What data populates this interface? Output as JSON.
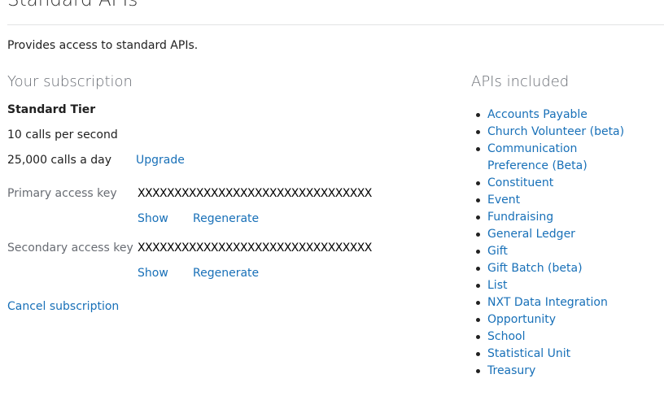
{
  "product": {
    "title": "Standard APIs",
    "description": "Provides access to standard APIs."
  },
  "subscription": {
    "heading": "Your subscription",
    "tier": "Standard Tier",
    "rate_limit": "10 calls per second",
    "daily_quota": "25,000 calls a day",
    "upgrade_label": "Upgrade",
    "primary_key": {
      "label": "Primary access key",
      "value": "XXXXXXXXXXXXXXXXXXXXXXXXXXXXXXXX",
      "show_label": "Show",
      "regenerate_label": "Regenerate"
    },
    "secondary_key": {
      "label": "Secondary access key",
      "value": "XXXXXXXXXXXXXXXXXXXXXXXXXXXXXXXX",
      "show_label": "Show",
      "regenerate_label": "Regenerate"
    },
    "cancel_label": "Cancel subscription"
  },
  "apis": {
    "heading": "APIs included",
    "items": [
      "Accounts Payable",
      "Church Volunteer (beta)",
      "Communication Preference (Beta)",
      "Constituent",
      "Event",
      "Fundraising",
      "General Ledger",
      "Gift",
      "Gift Batch (beta)",
      "List",
      "NXT Data Integration",
      "Opportunity",
      "School",
      "Statistical Unit",
      "Treasury"
    ]
  },
  "colors": {
    "link": "#1870b8",
    "muted": "#686c73",
    "text": "#212121"
  }
}
